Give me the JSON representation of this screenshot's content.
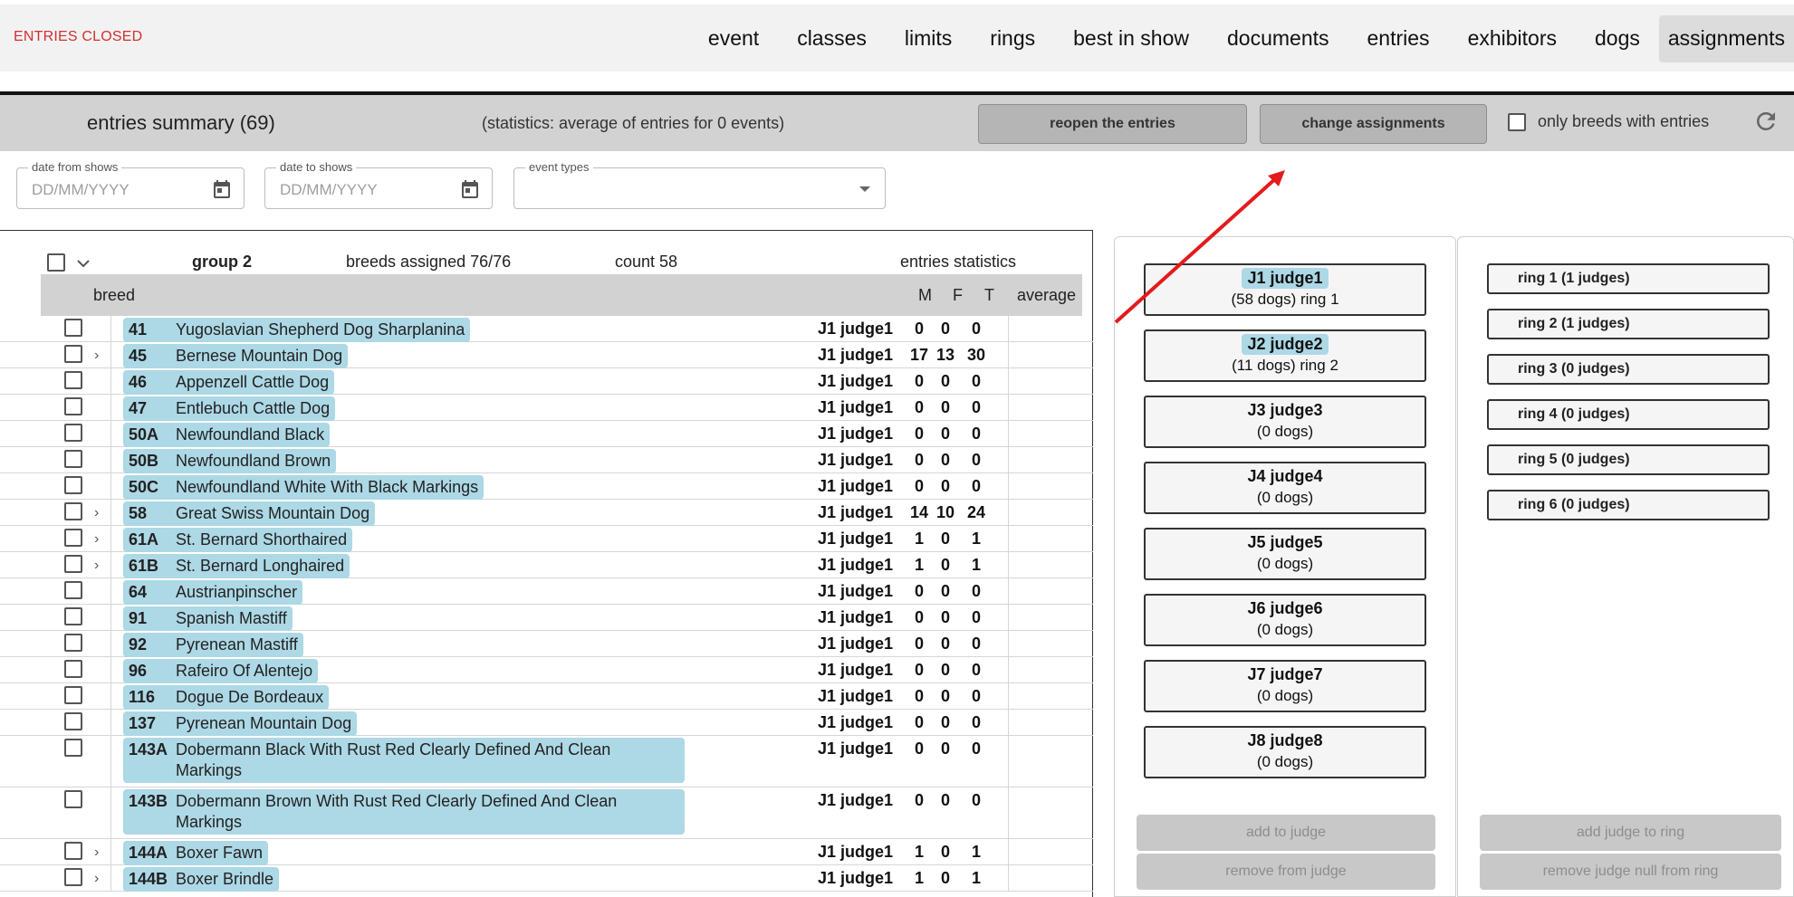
{
  "status": "ENTRIES CLOSED",
  "nav": [
    "event",
    "classes",
    "limits",
    "rings",
    "best in show",
    "documents",
    "entries",
    "exhibitors",
    "dogs",
    "assignments"
  ],
  "summary": {
    "title": "entries summary (69)",
    "stats": "(statistics: average of entries for 0 events)",
    "reopen_label": "reopen the entries",
    "change_label": "change assignments",
    "only_breeds_label": "only breeds with entries"
  },
  "filters": {
    "date_from_label": "date from shows",
    "date_from_placeholder": "DD/MM/YYYY",
    "date_to_label": "date to shows",
    "date_to_placeholder": "DD/MM/YYYY",
    "event_types_label": "event types"
  },
  "group": {
    "name": "group 2",
    "assigned": "breeds assigned 76/76",
    "count": "count 58",
    "stats_label": "entries statistics"
  },
  "columns": {
    "breed": "breed",
    "m": "M",
    "f": "F",
    "t": "T",
    "average": "average"
  },
  "rows": [
    {
      "code": "41",
      "name": "Yugoslavian Shepherd Dog Sharplanina",
      "judge": "J1 judge1",
      "m": "0",
      "f": "0",
      "t": "0",
      "expand": false
    },
    {
      "code": "45",
      "name": "Bernese Mountain Dog",
      "judge": "J1 judge1",
      "m": "17",
      "f": "13",
      "t": "30",
      "expand": true
    },
    {
      "code": "46",
      "name": "Appenzell Cattle Dog",
      "judge": "J1 judge1",
      "m": "0",
      "f": "0",
      "t": "0",
      "expand": false
    },
    {
      "code": "47",
      "name": "Entlebuch Cattle Dog",
      "judge": "J1 judge1",
      "m": "0",
      "f": "0",
      "t": "0",
      "expand": false
    },
    {
      "code": "50A",
      "name": "Newfoundland Black",
      "judge": "J1 judge1",
      "m": "0",
      "f": "0",
      "t": "0",
      "expand": false
    },
    {
      "code": "50B",
      "name": "Newfoundland Brown",
      "judge": "J1 judge1",
      "m": "0",
      "f": "0",
      "t": "0",
      "expand": false
    },
    {
      "code": "50C",
      "name": "Newfoundland White With Black Markings",
      "judge": "J1 judge1",
      "m": "0",
      "f": "0",
      "t": "0",
      "expand": false
    },
    {
      "code": "58",
      "name": "Great Swiss Mountain Dog",
      "judge": "J1 judge1",
      "m": "14",
      "f": "10",
      "t": "24",
      "expand": true
    },
    {
      "code": "61A",
      "name": "St. Bernard Shorthaired",
      "judge": "J1 judge1",
      "m": "1",
      "f": "0",
      "t": "1",
      "expand": true
    },
    {
      "code": "61B",
      "name": "St. Bernard Longhaired",
      "judge": "J1 judge1",
      "m": "1",
      "f": "0",
      "t": "1",
      "expand": true
    },
    {
      "code": "64",
      "name": "Austrianpinscher",
      "judge": "J1 judge1",
      "m": "0",
      "f": "0",
      "t": "0",
      "expand": false
    },
    {
      "code": "91",
      "name": "Spanish Mastiff",
      "judge": "J1 judge1",
      "m": "0",
      "f": "0",
      "t": "0",
      "expand": false
    },
    {
      "code": "92",
      "name": "Pyrenean Mastiff",
      "judge": "J1 judge1",
      "m": "0",
      "f": "0",
      "t": "0",
      "expand": false
    },
    {
      "code": "96",
      "name": "Rafeiro Of Alentejo",
      "judge": "J1 judge1",
      "m": "0",
      "f": "0",
      "t": "0",
      "expand": false
    },
    {
      "code": "116",
      "name": "Dogue De Bordeaux",
      "judge": "J1 judge1",
      "m": "0",
      "f": "0",
      "t": "0",
      "expand": false
    },
    {
      "code": "137",
      "name": "Pyrenean Mountain Dog",
      "judge": "J1 judge1",
      "m": "0",
      "f": "0",
      "t": "0",
      "expand": false
    },
    {
      "code": "143A",
      "name": "Dobermann Black With Rust Red Clearly Defined And Clean Markings",
      "judge": "J1 judge1",
      "m": "0",
      "f": "0",
      "t": "0",
      "expand": false
    },
    {
      "code": "143B",
      "name": "Dobermann Brown With Rust Red Clearly Defined And Clean Markings",
      "judge": "J1 judge1",
      "m": "0",
      "f": "0",
      "t": "0",
      "expand": false
    },
    {
      "code": "144A",
      "name": "Boxer Fawn",
      "judge": "J1 judge1",
      "m": "1",
      "f": "0",
      "t": "1",
      "expand": true
    },
    {
      "code": "144B",
      "name": "Boxer Brindle",
      "judge": "J1 judge1",
      "m": "1",
      "f": "0",
      "t": "1",
      "expand": true
    }
  ],
  "judges": [
    {
      "name": "J1 judge1",
      "info": "(58 dogs) ring 1",
      "highlight": true
    },
    {
      "name": "J2 judge2",
      "info": "(11 dogs) ring 2",
      "highlight": true
    },
    {
      "name": "J3 judge3",
      "info": "(0 dogs)",
      "highlight": false
    },
    {
      "name": "J4 judge4",
      "info": "(0 dogs)",
      "highlight": false
    },
    {
      "name": "J5 judge5",
      "info": "(0 dogs)",
      "highlight": false
    },
    {
      "name": "J6 judge6",
      "info": "(0 dogs)",
      "highlight": false
    },
    {
      "name": "J7 judge7",
      "info": "(0 dogs)",
      "highlight": false
    },
    {
      "name": "J8 judge8",
      "info": "(0 dogs)",
      "highlight": false
    }
  ],
  "rings": [
    "ring 1 (1 judges)",
    "ring 2 (1 judges)",
    "ring 3 (0 judges)",
    "ring 4 (0 judges)",
    "ring 5 (0 judges)",
    "ring 6 (0 judges)"
  ],
  "judge_buttons": {
    "add": "add to judge",
    "remove": "remove from judge"
  },
  "ring_buttons": {
    "add": "add judge to ring",
    "remove": "remove judge null from ring"
  },
  "colors": {
    "status": "#d32f2f",
    "highlight": "#add8e6",
    "annotation": "#e31b1b"
  },
  "icons": [
    "calendar-icon",
    "dropdown-arrow-icon",
    "refresh-icon",
    "chevron-down-icon",
    "chevron-right-icon",
    "annotation-arrow"
  ]
}
